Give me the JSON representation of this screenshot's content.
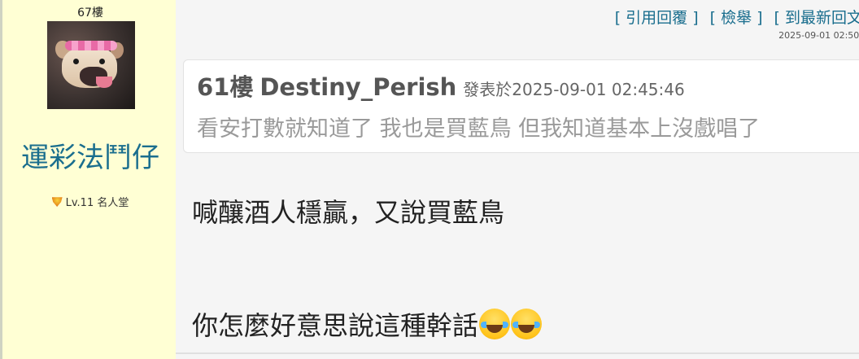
{
  "sidebar": {
    "floor": "67樓",
    "avatar_alt": "dog-avatar",
    "username": "運彩法鬥仔",
    "level": "Lv.11 名人堂"
  },
  "actions": {
    "reply_quote": "[ 引用回覆 ]",
    "report": "[ 檢舉 ]",
    "to_latest": "[ 到最新回文"
  },
  "post_time": "2025-09-01 02:50:",
  "quote": {
    "floor": "61樓",
    "author": "Destiny_Perish",
    "meta": "發表於2025-09-01 02:45:46",
    "text": "看安打數就知道了 我也是買藍鳥 但我知道基本上沒戲唱了"
  },
  "body": {
    "line1": "喊釀酒人穩贏，又說買藍鳥",
    "line2": "你怎麼好意思說這種幹話",
    "emoji": "tears-of-joy"
  }
}
